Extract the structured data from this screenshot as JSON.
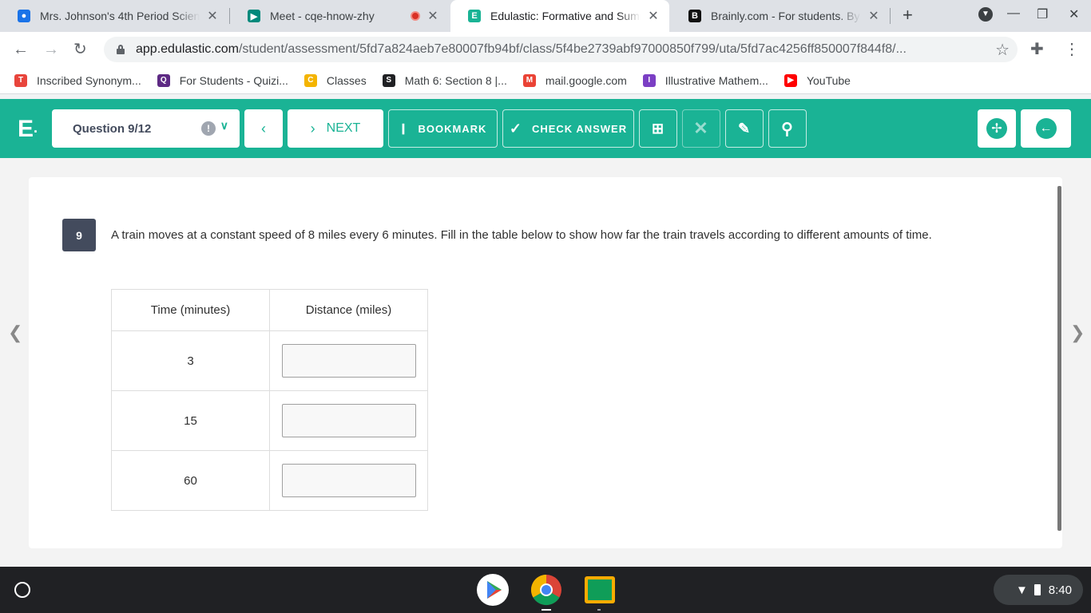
{
  "browser": {
    "tabs": [
      {
        "title": "Mrs. Johnson's 4th Period Science",
        "active": false
      },
      {
        "title": "Meet - cqe-hnow-zhy",
        "active": false
      },
      {
        "title": "Edulastic: Formative and Summative",
        "active": true
      },
      {
        "title": "Brainly.com - For students. By students.",
        "active": false
      }
    ],
    "url_host": "app.edulastic.com",
    "url_path": "/student/assessment/5fd7a824aeb7e80007fb94bf/class/5f4be2739abf97000850f799/uta/5fd7ac4256ff850007f844f8/...",
    "bookmarks": [
      {
        "label": "Inscribed Synonym...",
        "color": "#e8453c",
        "glyph": "T"
      },
      {
        "label": "For Students - Quizi...",
        "color": "#5e2a84",
        "glyph": "Q"
      },
      {
        "label": "Classes",
        "color": "#f4b400",
        "glyph": "C"
      },
      {
        "label": "Math 6: Section 8 |...",
        "color": "#202124",
        "glyph": "S"
      },
      {
        "label": "mail.google.com",
        "color": "#ea4335",
        "glyph": "M"
      },
      {
        "label": "Illustrative Mathem...",
        "color": "#7b3fc4",
        "glyph": "I"
      },
      {
        "label": "YouTube",
        "color": "#ff0000",
        "glyph": "▶"
      }
    ]
  },
  "header": {
    "logo": "E",
    "question_selector": "Question 9/12",
    "next_label": "NEXT",
    "bookmark_label": "BOOKMARK",
    "check_answer_label": "CHECK ANSWER",
    "accent_color": "#1ab395"
  },
  "question": {
    "number": "9",
    "text": "A train moves at a constant speed of 8 miles every 6 minutes. Fill in the table below to show how far the train travels according to different amounts of time.",
    "table": {
      "headers": [
        "Time (minutes)",
        "Distance (miles)"
      ],
      "rows": [
        {
          "time": "3",
          "distance": ""
        },
        {
          "time": "15",
          "distance": ""
        },
        {
          "time": "60",
          "distance": ""
        }
      ]
    }
  },
  "system": {
    "clock": "8:40"
  }
}
